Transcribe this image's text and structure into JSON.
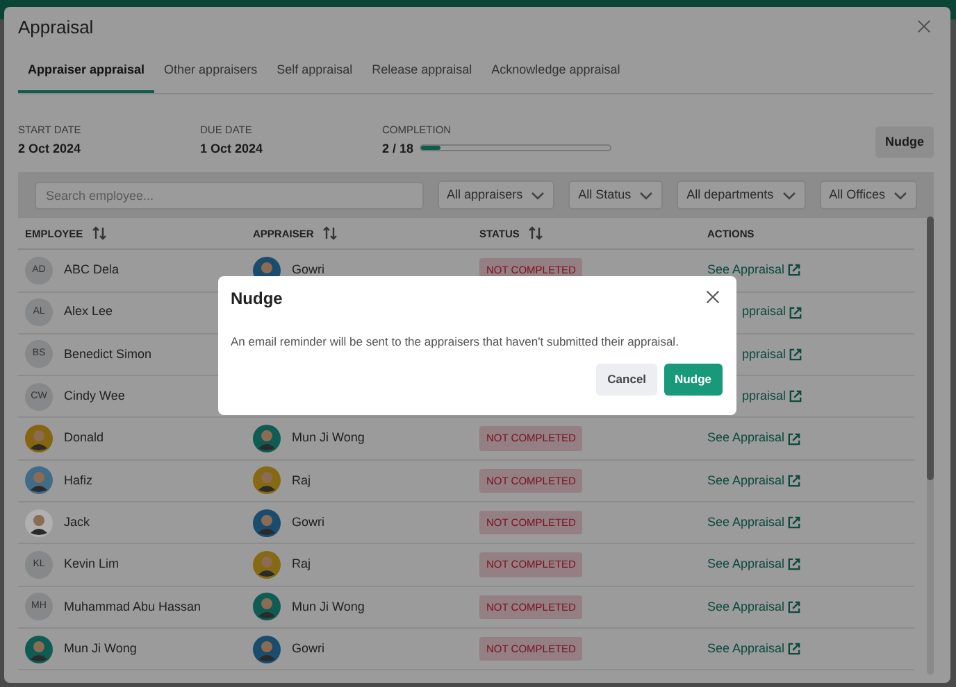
{
  "dialog": {
    "title": "Appraisal",
    "tabs": [
      {
        "label": "Appraiser appraisal",
        "selected": true
      },
      {
        "label": "Other appraisers",
        "selected": false
      },
      {
        "label": "Self appraisal",
        "selected": false
      },
      {
        "label": "Release appraisal",
        "selected": false
      },
      {
        "label": "Acknowledge appraisal",
        "selected": false
      }
    ],
    "stats": [
      {
        "label": "START DATE",
        "value": "2 Oct 2024"
      },
      {
        "label": "DUE DATE",
        "value": "1 Oct 2024"
      }
    ],
    "completion": {
      "label": "COMPLETION",
      "value": "2 / 18",
      "level": 0.11
    },
    "nudge_button": "Nudge",
    "filters": {
      "search": {
        "placeholder": "Search employee..."
      },
      "dropdowns": [
        "All appraisers",
        "All Status",
        "All departments",
        "All Offices"
      ]
    },
    "table": {
      "columns": [
        {
          "label": "EMPLOYEE",
          "sortable": true
        },
        {
          "label": "APPRAISER",
          "sortable": true
        },
        {
          "label": "STATUS",
          "sortable": true
        },
        {
          "label": "ACTIONS",
          "sortable": false
        }
      ],
      "rows": [
        {
          "employee": "ABC Dela",
          "employee_avatar": {
            "kind": "initials",
            "text": "AD"
          },
          "appraiser": "Gowri",
          "appraiser_avatar": {
            "kind": "photo",
            "color": "#1a4c6e"
          },
          "status": "NOT COMPLETED",
          "action": "See Appraisal"
        },
        {
          "employee": "Alex Lee",
          "employee_avatar": {
            "kind": "initials",
            "text": "AL"
          },
          "action": "ppraisal",
          "partly_hidden": true
        },
        {
          "employee": "Benedict Simon",
          "employee_avatar": {
            "kind": "initials",
            "text": "BS"
          },
          "action": "ppraisal",
          "partly_hidden": true
        },
        {
          "employee": "Cindy Wee",
          "employee_avatar": {
            "kind": "initials",
            "text": "CW"
          },
          "action": "ppraisal",
          "partly_hidden": true
        },
        {
          "employee": "Donald",
          "employee_avatar": {
            "kind": "photo",
            "color": "#866510"
          },
          "appraiser": "Mun Ji Wong",
          "appraiser_avatar": {
            "kind": "photo",
            "color": "#0e5c53"
          },
          "status": "NOT COMPLETED",
          "action": "See Appraisal"
        },
        {
          "employee": "Hafiz",
          "employee_avatar": {
            "kind": "photo",
            "color": "#416c89"
          },
          "appraiser": "Raj",
          "appraiser_avatar": {
            "kind": "photo",
            "color": "#866a13"
          },
          "status": "NOT COMPLETED",
          "action": "See Appraisal"
        },
        {
          "employee": "Jack",
          "employee_avatar": {
            "kind": "photo",
            "color": "#b0b0b0"
          },
          "appraiser": "Gowri",
          "appraiser_avatar": {
            "kind": "photo",
            "color": "#1a4c6e"
          },
          "status": "NOT COMPLETED",
          "action": "See Appraisal"
        },
        {
          "employee": "Kevin Lim",
          "employee_avatar": {
            "kind": "initials",
            "text": "KL"
          },
          "appraiser": "Raj",
          "appraiser_avatar": {
            "kind": "photo",
            "color": "#866a13"
          },
          "status": "NOT COMPLETED",
          "action": "See Appraisal"
        },
        {
          "employee": "Muhammad Abu Hassan",
          "employee_avatar": {
            "kind": "initials",
            "text": "MH"
          },
          "appraiser": "Mun Ji Wong",
          "appraiser_avatar": {
            "kind": "photo",
            "color": "#0e5c53"
          },
          "status": "NOT COMPLETED",
          "action": "See Appraisal"
        },
        {
          "employee": "Mun Ji Wong",
          "employee_avatar": {
            "kind": "photo",
            "color": "#0e5c53"
          },
          "appraiser": "Gowri",
          "appraiser_avatar": {
            "kind": "photo",
            "color": "#1a4c6e"
          },
          "status": "NOT COMPLETED",
          "action": "See Appraisal"
        }
      ]
    }
  },
  "modal": {
    "title": "Nudge",
    "message": "An email reminder will be sent to the appraisers that haven't submitted their appraisal.",
    "buttons": [
      {
        "label": "Cancel",
        "kind": "secondary"
      },
      {
        "label": "Nudge",
        "kind": "primary"
      }
    ]
  }
}
